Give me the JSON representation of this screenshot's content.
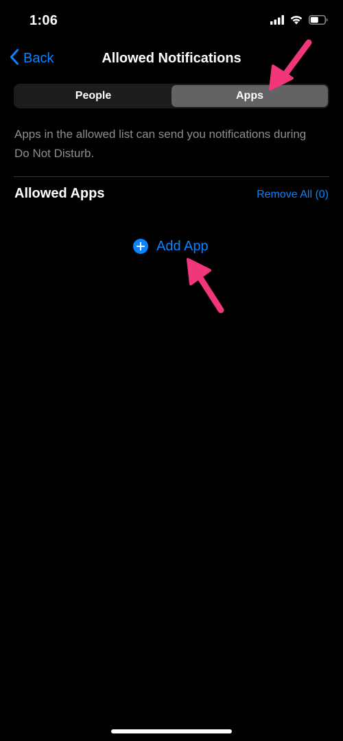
{
  "status_bar": {
    "time": "1:06",
    "icons": [
      "cellular-signal-icon",
      "wifi-icon",
      "battery-icon"
    ]
  },
  "nav": {
    "back_label": "Back",
    "title": "Allowed Notifications"
  },
  "segments": {
    "people_label": "People",
    "apps_label": "Apps",
    "selected": "Apps"
  },
  "description": "Apps in the allowed list can send you notifications during Do Not Disturb.",
  "section": {
    "title": "Allowed Apps",
    "remove_all_label": "Remove All (0)"
  },
  "add_app": {
    "label": "Add App",
    "icon": "plus-circle-icon"
  },
  "annotations": {
    "arrow_color": "#f2367a",
    "count": 2
  },
  "colors": {
    "accent": "#0a84ff",
    "background": "#000000",
    "segment_track": "#1c1c1e",
    "segment_selected": "#636366",
    "secondary_text": "#8e8e93",
    "divider": "#38383a"
  }
}
